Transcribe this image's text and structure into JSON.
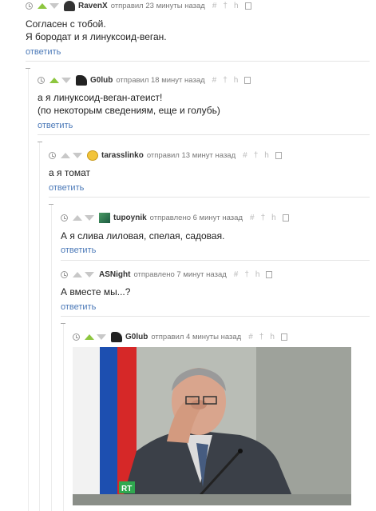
{
  "comments": [
    {
      "user": "RavenX",
      "meta": "отправил 23 минуты назад",
      "avatar": "dark-avatar",
      "upvoted": true,
      "lines": [
        "Согласен с тобой.",
        "Я бородат и я линуксоид-веган."
      ],
      "reply": "ответить"
    },
    {
      "user": "G0lub",
      "meta": "отправил 18 минут назад",
      "avatar": "dark-avatar",
      "upvoted": true,
      "lines": [
        "а я линуксоид-веган-атеист!",
        "(по некоторым сведениям, еще и голубь)"
      ],
      "reply": "ответить"
    },
    {
      "user": "tarasslinko",
      "meta": "отправил 13 минут назад",
      "avatar": "smiley-avatar",
      "upvoted": false,
      "lines": [
        "а я томат"
      ],
      "reply": "ответить"
    },
    {
      "user": "tupoynik",
      "meta": "отправлено 6 минут назад",
      "avatar": "green-avatar",
      "upvoted": false,
      "lines": [
        "А я слива лиловая, спелая, садовая."
      ],
      "reply": "ответить"
    },
    {
      "user": "ASNight",
      "meta": "отправлено 7 минут назад",
      "avatar": "none",
      "upvoted": false,
      "lines": [
        "А вместе мы...?"
      ],
      "reply": "ответить"
    },
    {
      "user": "G0lub",
      "meta": "отправил 4 минуты назад",
      "avatar": "dark-avatar",
      "upvoted": true,
      "lines": [],
      "reply": ""
    }
  ],
  "tools": [
    "#",
    "†",
    "h",
    "save-icon"
  ],
  "image": {
    "badge": "RT"
  },
  "colors": {
    "link": "#4b79b8",
    "upvote": "#8dc63f",
    "muted": "#c8c8c8"
  }
}
